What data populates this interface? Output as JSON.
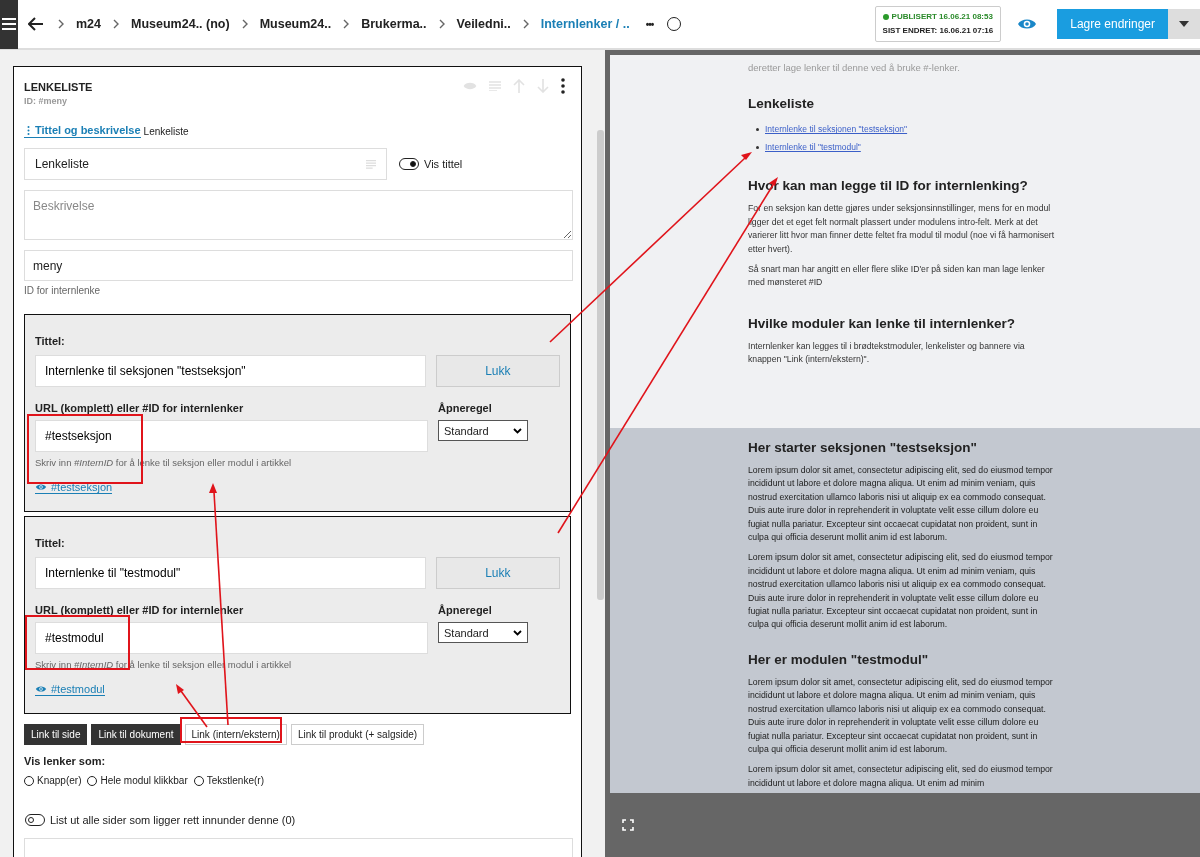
{
  "topbar": {
    "breadcrumbs": [
      {
        "label": "m24",
        "current": false
      },
      {
        "label": "Museum24.. (no)",
        "current": false
      },
      {
        "label": "Museum24..",
        "current": false
      },
      {
        "label": "Brukerma..",
        "current": false
      },
      {
        "label": "Veiledni..",
        "current": false
      },
      {
        "label": "Internlenker / ..",
        "current": true
      }
    ],
    "more": "•••",
    "published": "PUBLISERT 16.06.21 08:53",
    "changed": "SIST ENDRET: 16.06.21 07:16",
    "save": "Lagre endringer"
  },
  "editor": {
    "module_title": "LENKELISTE",
    "module_id": "ID: #meny",
    "section_tab": "Tittel og beskrivelse",
    "section_tab_suffix": "Lenkeliste",
    "title_value": "Lenkeliste",
    "show_title": {
      "label": "Vis tittel",
      "on": true
    },
    "description_placeholder": "Beskrivelse",
    "id_value": "meny",
    "id_hint": "ID for internlenke",
    "links": [
      {
        "title_label": "Tittel:",
        "title": "Internlenke til seksjonen \"testseksjon\"",
        "close": "Lukk",
        "url_label": "URL (komplett) eller #ID for internlenker",
        "url": "#testseksjon",
        "open_label": "Åpneregel",
        "open_rule": "Standard",
        "hint": "Skriv inn *#InternID* for å lenke til seksjon eller modul i artikkel",
        "preview": "#testseksjon"
      },
      {
        "title_label": "Tittel:",
        "title": "Internlenke til \"testmodul\"",
        "close": "Lukk",
        "url_label": "URL (komplett) eller #ID for internlenker",
        "url": "#testmodul",
        "open_label": "Åpneregel",
        "open_rule": "Standard",
        "hint": "Skriv inn *#InternID* for å lenke til seksjon eller modul i artikkel",
        "preview": "#testmodul"
      }
    ],
    "add_buttons": [
      {
        "label": "Link til side",
        "kind": "dark"
      },
      {
        "label": "Link til dokument",
        "kind": "dark"
      },
      {
        "label": "Link (intern/ekstern)",
        "kind": "light"
      },
      {
        "label": "Link til produkt (+ salgside)",
        "kind": "light"
      }
    ],
    "show_as": {
      "label": "Vis lenker som:",
      "options": [
        {
          "label": "Knapp(er)",
          "selected": false
        },
        {
          "label": "Hele modul klikkbar",
          "selected": false
        },
        {
          "label": "Tekstlenke(r)",
          "selected": false
        }
      ]
    },
    "list_children": {
      "label": "List ut alle sider som ligger rett innunder denne (0)",
      "on": false
    }
  },
  "preview": {
    "intro": "deretter lage lenker til denne ved å bruke #-lenker.",
    "link_list_heading": "Lenkeliste",
    "link_list": [
      "Internlenke til seksjonen \"testseksjon\"",
      "Internlenke til \"testmodul\""
    ],
    "blocks": [
      {
        "heading": "Hvor kan man legge til ID for internlenking?",
        "paragraphs": [
          "For en seksjon kan dette gjøres under  seksjonsinnstillinger, mens for en modul ligger det et eget felt normalt plassert under modulens intro-felt. Merk at det varierer litt hvor man finner dette feltet fra modul til modul (noe vi få harmonisert etter hvert).",
          "Så snart man har angitt en eller flere slike ID'er på siden kan man lage lenker med mønsteret #ID"
        ]
      },
      {
        "heading": "Hvilke moduler kan lenke til internlenker?",
        "paragraphs": [
          "Internlenker kan legges til i  brødtekstmoduler, lenkelister og bannere via knappen \"Link (intern/ekstern)\"."
        ]
      }
    ],
    "sections": [
      {
        "heading": "Her starter seksjonen \"testseksjon\"",
        "paragraphs": [
          "Lorem ipsum dolor sit amet, consectetur adipiscing elit, sed do eiusmod tempor incididunt ut labore et dolore magna aliqua. Ut enim ad minim veniam, quis nostrud exercitation ullamco laboris nisi ut aliquip ex ea commodo consequat. Duis aute irure dolor in reprehenderit in voluptate velit esse cillum dolore eu fugiat nulla pariatur. Excepteur sint occaecat cupidatat non proident, sunt in culpa qui officia deserunt mollit anim id est laborum.",
          "Lorem ipsum dolor sit amet, consectetur adipiscing elit, sed do eiusmod tempor incididunt ut labore et dolore magna aliqua. Ut enim ad minim veniam, quis nostrud exercitation ullamco laboris nisi ut aliquip ex ea commodo consequat. Duis aute irure dolor in reprehenderit in voluptate velit esse cillum dolore eu fugiat nulla pariatur. Excepteur sint occaecat cupidatat non proident, sunt in culpa qui officia deserunt mollit anim id est laborum."
        ]
      },
      {
        "heading": "Her er modulen \"testmodul\"",
        "paragraphs": [
          "Lorem ipsum dolor sit amet, consectetur adipiscing elit, sed do eiusmod tempor incididunt ut labore et dolore magna aliqua. Ut enim ad minim veniam, quis nostrud exercitation ullamco laboris nisi ut aliquip ex ea commodo consequat. Duis aute irure dolor in reprehenderit in voluptate velit esse cillum dolore eu fugiat nulla pariatur. Excepteur sint occaecat cupidatat non proident, sunt in culpa qui officia deserunt mollit anim id est laborum.",
          "Lorem ipsum dolor sit amet, consectetur adipiscing elit, sed do eiusmod tempor incididunt ut labore et dolore magna aliqua. Ut enim ad minim"
        ]
      }
    ]
  }
}
